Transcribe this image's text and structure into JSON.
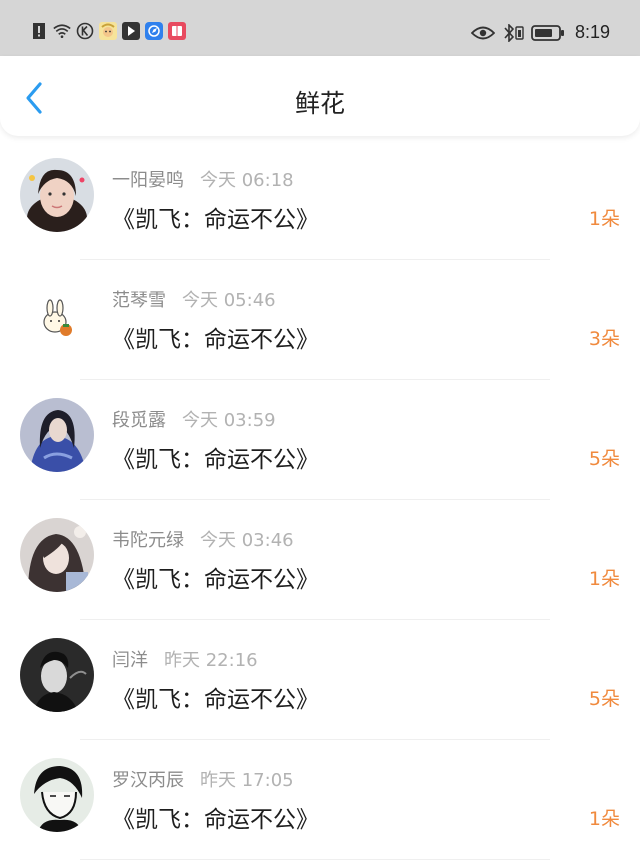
{
  "status_bar": {
    "time": "8:19",
    "icons_left": [
      "alert-icon",
      "wifi-icon",
      "k-app-icon",
      "cartoon-app-icon",
      "bookmark-app-icon",
      "compass-app-icon",
      "book-app-icon"
    ],
    "icons_right": [
      "eye-icon",
      "bluetooth-icon",
      "battery-icon"
    ]
  },
  "header": {
    "title": "鲜花"
  },
  "rows": [
    {
      "name": "一阳晏鸣",
      "time": "今天 06:18",
      "book": "《凯飞：命运不公》",
      "count": "1朵"
    },
    {
      "name": "范琴雪",
      "time": "今天 05:46",
      "book": "《凯飞：命运不公》",
      "count": "3朵"
    },
    {
      "name": "段觅露",
      "time": "今天 03:59",
      "book": "《凯飞：命运不公》",
      "count": "5朵"
    },
    {
      "name": "韦陀元绿",
      "time": "今天 03:46",
      "book": "《凯飞：命运不公》",
      "count": "1朵"
    },
    {
      "name": "闫洋",
      "time": "昨天 22:16",
      "book": "《凯飞：命运不公》",
      "count": "5朵"
    },
    {
      "name": "罗汉丙辰",
      "time": "昨天 17:05",
      "book": "《凯飞：命运不公》",
      "count": "1朵"
    }
  ],
  "colors": {
    "accent": "#2b9cf0",
    "count": "#f08a3e",
    "status_bar": "#d6d6d6"
  }
}
